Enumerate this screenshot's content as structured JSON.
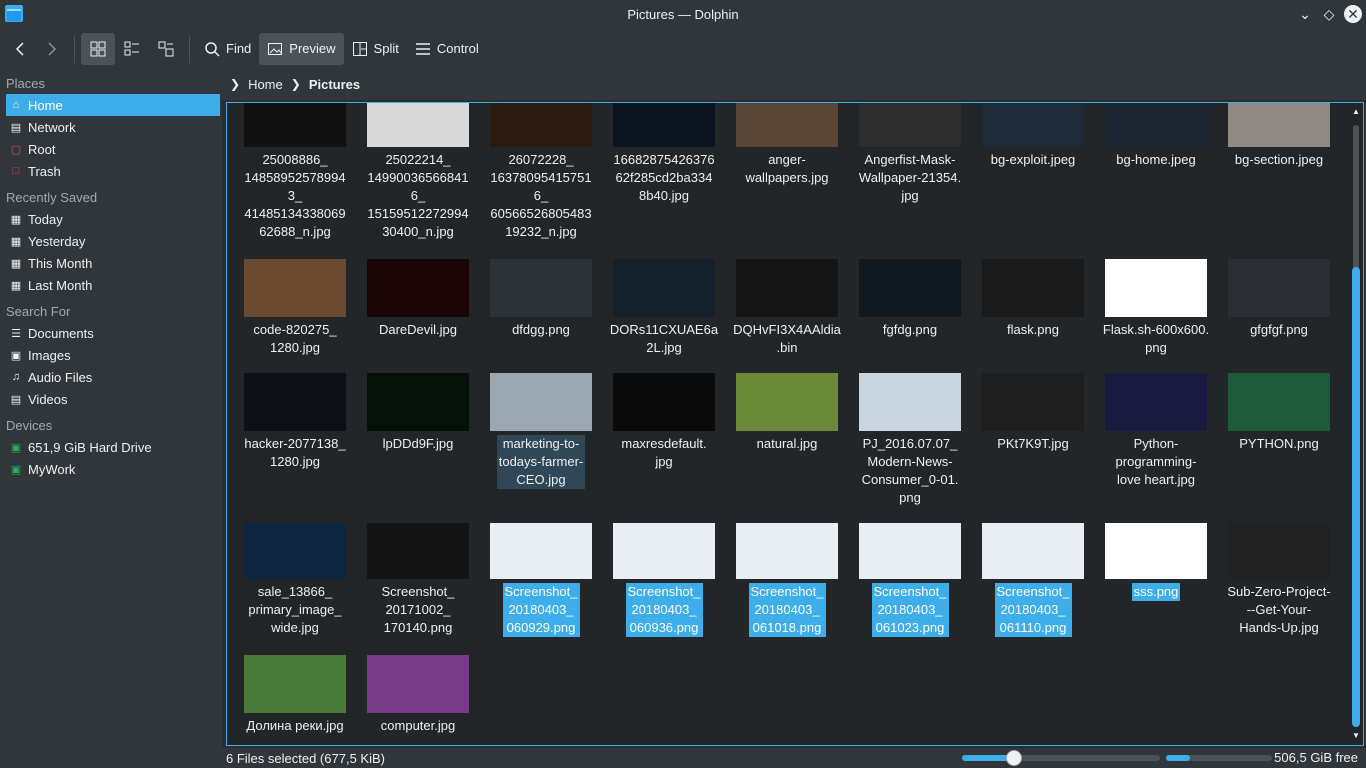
{
  "window": {
    "title": "Pictures — Dolphin"
  },
  "toolbar": {
    "find": "Find",
    "preview": "Preview",
    "split": "Split",
    "control": "Control"
  },
  "sidebar": {
    "places_title": "Places",
    "places": [
      {
        "label": "Home",
        "icon": "home-icon"
      },
      {
        "label": "Network",
        "icon": "network-icon"
      },
      {
        "label": "Root",
        "icon": "root-folder-icon"
      },
      {
        "label": "Trash",
        "icon": "trash-icon"
      }
    ],
    "recent_title": "Recently Saved",
    "recent": [
      {
        "label": "Today",
        "icon": "calendar-icon"
      },
      {
        "label": "Yesterday",
        "icon": "calendar-icon"
      },
      {
        "label": "This Month",
        "icon": "calendar-icon"
      },
      {
        "label": "Last Month",
        "icon": "calendar-icon"
      }
    ],
    "search_title": "Search For",
    "search": [
      {
        "label": "Documents",
        "icon": "documents-icon"
      },
      {
        "label": "Images",
        "icon": "images-icon"
      },
      {
        "label": "Audio Files",
        "icon": "audio-icon"
      },
      {
        "label": "Videos",
        "icon": "videos-icon"
      }
    ],
    "devices_title": "Devices",
    "devices": [
      {
        "label": "651,9 GiB Hard Drive",
        "icon": "hard-drive-icon"
      },
      {
        "label": "MyWork",
        "icon": "hard-drive-icon"
      }
    ]
  },
  "breadcrumb": {
    "home": "Home",
    "current": "Pictures"
  },
  "files": [
    {
      "name": "25008886_\n14858952578994\n3_\n41485134338069\n62688_n.jpg",
      "color": "#111111"
    },
    {
      "name": "25022214_\n14990036566841\n6_\n15159512272994\n30400_n.jpg",
      "color": "#d9d9d9"
    },
    {
      "name": "26072228_\n16378095415751\n6_\n60566526805483\n19232_n.jpg",
      "color": "#2b1a10"
    },
    {
      "name": "16682875426376\n62f285cd2ba334\n8b40.jpg",
      "color": "#0b1420"
    },
    {
      "name": "anger-\nwallpapers.jpg",
      "color": "#5a4636"
    },
    {
      "name": "Angerfist-Mask-\nWallpaper-21354.\njpg",
      "color": "#2e2e2e"
    },
    {
      "name": "bg-exploit.jpeg",
      "color": "#1e2a38"
    },
    {
      "name": "bg-home.jpeg",
      "color": "#1c2733"
    },
    {
      "name": "bg-section.jpeg",
      "color": "#8f8a84"
    },
    {
      "name": "code-820275_\n1280.jpg",
      "color": "#6b4a30"
    },
    {
      "name": "DareDevil.jpg",
      "color": "#1a0404"
    },
    {
      "name": "dfdgg.png",
      "color": "#2c3338"
    },
    {
      "name": "DORs11CXUAE6a\n2L.jpg",
      "color": "#14202c"
    },
    {
      "name": "DQHvFI3X4AAldia\n.bin",
      "color": "#151515"
    },
    {
      "name": "fgfdg.png",
      "color": "#101820"
    },
    {
      "name": "flask.png",
      "color": "#1a1a1a"
    },
    {
      "name": "Flask.sh-600x600.\npng",
      "color": "#ffffff"
    },
    {
      "name": "gfgfgf.png",
      "color": "#2b2f33"
    },
    {
      "name": "hacker-2077138_\n1280.jpg",
      "color": "#0e1018"
    },
    {
      "name": "lpDDd9F.jpg",
      "color": "#041008"
    },
    {
      "name": "marketing-to-\ntodays-farmer-\nCEO.jpg",
      "color": "#9aa6b0"
    },
    {
      "name": "maxresdefault.\njpg",
      "color": "#0a0a0a"
    },
    {
      "name": "natural.jpg",
      "color": "#6a8a3a"
    },
    {
      "name": "PJ_2016.07.07_\nModern-News-\nConsumer_0-01.\npng",
      "color": "#c9d6e0"
    },
    {
      "name": "PKt7K9T.jpg",
      "color": "#1e1e1e"
    },
    {
      "name": "Python-\nprogramming-\nlove heart.jpg",
      "color": "#1a1a40"
    },
    {
      "name": "PYTHON.png",
      "color": "#1d5a3a"
    },
    {
      "name": "sale_13866_\nprimary_image_\nwide.jpg",
      "color": "#0f2640"
    },
    {
      "name": "Screenshot_\n20171002_\n170140.png",
      "color": "#141414"
    },
    {
      "name": "Screenshot_\n20180403_\n060929.png",
      "color": "#e8eef3"
    },
    {
      "name": "Screenshot_\n20180403_\n060936.png",
      "color": "#e8eef3"
    },
    {
      "name": "Screenshot_\n20180403_\n061018.png",
      "color": "#e8eef3"
    },
    {
      "name": "Screenshot_\n20180403_\n061023.png",
      "color": "#e8eef3"
    },
    {
      "name": "Screenshot_\n20180403_\n061110.png",
      "color": "#e8eef3"
    },
    {
      "name": "sss.png",
      "color": "#ffffff"
    },
    {
      "name": "Sub-Zero-Project-\n--Get-Your-\nHands-Up.jpg",
      "color": "#222222"
    },
    {
      "name": "Долина реки.jpg",
      "color": "#4a7a3a"
    },
    {
      "name": "computer.jpg",
      "color": "#7a3a8a"
    }
  ],
  "selected_files": [
    "Screenshot_\n20180403_\n060929.png",
    "Screenshot_\n20180403_\n060936.png",
    "Screenshot_\n20180403_\n061018.png",
    "Screenshot_\n20180403_\n061023.png",
    "Screenshot_\n20180403_\n061110.png",
    "sss.png"
  ],
  "hover_file": "marketing-to-\ntodays-farmer-\nCEO.jpg",
  "status": {
    "selection": "6 Files selected (677,5 KiB)",
    "free_space": "506,5 GiB free"
  },
  "colors": {
    "accent": "#3daee9",
    "background": "#232629",
    "panel": "#31363b"
  }
}
